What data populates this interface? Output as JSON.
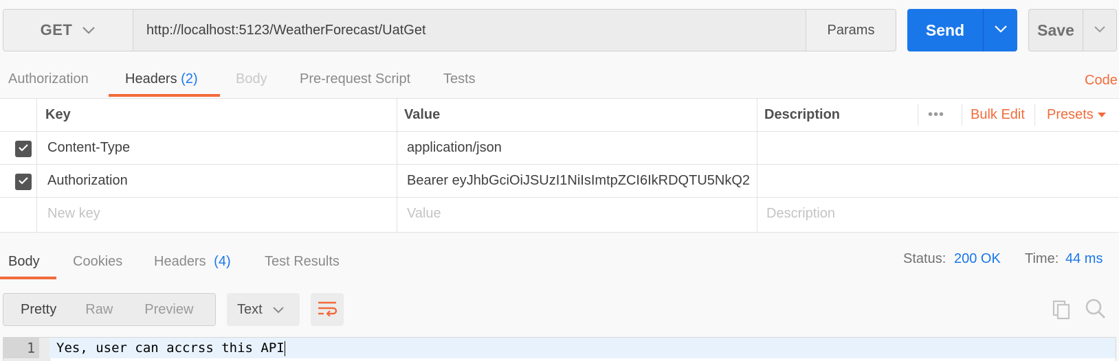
{
  "request": {
    "method": "GET",
    "url": "http://localhost:5123/WeatherForecast/UatGet",
    "params_label": "Params",
    "send_label": "Send",
    "save_label": "Save"
  },
  "request_tabs": {
    "authorization": "Authorization",
    "headers": "Headers",
    "headers_count": "(2)",
    "body": "Body",
    "prerequest": "Pre-request Script",
    "tests": "Tests",
    "code": "Code"
  },
  "headers_table": {
    "columns": {
      "key": "Key",
      "value": "Value",
      "description": "Description"
    },
    "more": "•••",
    "bulk_edit": "Bulk Edit",
    "presets": "Presets",
    "rows": [
      {
        "key": "Content-Type",
        "value": "application/json",
        "checked": true
      },
      {
        "key": "Authorization",
        "value": "Bearer eyJhbGciOiJSUzI1NiIsImtpZCI6IkRDQTU5NkQ2...",
        "checked": true
      }
    ],
    "new_row": {
      "key_placeholder": "New key",
      "value_placeholder": "Value",
      "description_placeholder": "Description"
    }
  },
  "response_tabs": {
    "body": "Body",
    "cookies": "Cookies",
    "headers": "Headers",
    "headers_count": "(4)",
    "test_results": "Test Results"
  },
  "response_status": {
    "status_label": "Status:",
    "status_value": "200 OK",
    "time_label": "Time:",
    "time_value": "44 ms"
  },
  "response_view": {
    "modes": [
      "Pretty",
      "Raw",
      "Preview"
    ],
    "active_mode": "Pretty",
    "format": "Text"
  },
  "response_body": {
    "line_number": "1",
    "text": "Yes, user can accrss this API"
  },
  "colors": {
    "accent_orange": "#f26b3a",
    "send_blue": "#1a77ea"
  },
  "icons": [
    "chevron-down-icon",
    "wrap-lines-icon",
    "copy-icon",
    "search-icon",
    "check-icon",
    "caret-down-icon"
  ]
}
